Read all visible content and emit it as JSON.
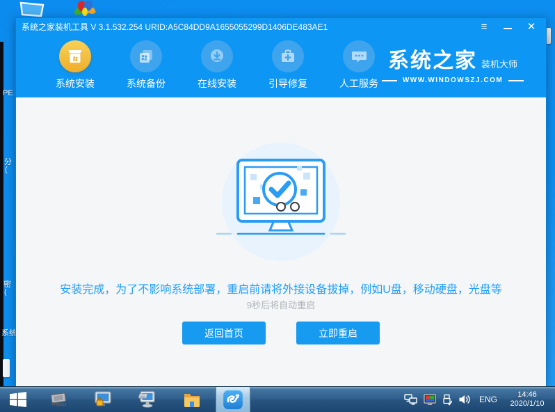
{
  "colors": {
    "chrome_blue": "#0e96f4",
    "desktop_blue": "#0d90f2",
    "accent_gold": "#efae29",
    "message_blue": "#1e9fff",
    "button_blue": "#169bf0",
    "content_bg": "#f5f6f7"
  },
  "window": {
    "title": "系统之家装机工具 V 3.1.532.254 URID:A5C84DD9A1655055299D1406DE483AE1",
    "controls": {
      "menu": "≡",
      "close": "✕"
    }
  },
  "nav": {
    "items": [
      {
        "label": "系统安装",
        "active": true
      },
      {
        "label": "系统备份",
        "active": false
      },
      {
        "label": "在线安装",
        "active": false
      },
      {
        "label": "引导修复",
        "active": false
      },
      {
        "label": "人工服务",
        "active": false
      }
    ]
  },
  "logo": {
    "name": "系统之家",
    "tagline": "装机大师",
    "url": "WWW.WINDOWSZJ.COM"
  },
  "main": {
    "message": "安装完成，为了不影响系统部署，重启前请将外接设备拔掉，例如U盘，移动硬盘，光盘等",
    "countdown": "9秒后将自动重启",
    "back_button": "返回首页",
    "restart_button": "立即重启"
  },
  "desktop": {
    "fragments": [
      "PE",
      "分",
      "(",
      "密",
      "(",
      "系统"
    ]
  },
  "taskbar": {
    "language": "ENG",
    "time": "14:46",
    "date": "2020/1/10"
  }
}
